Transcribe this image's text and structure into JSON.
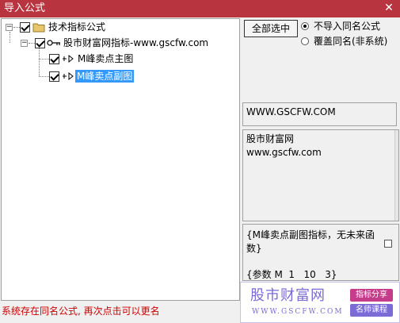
{
  "window": {
    "title": "导入公式"
  },
  "tree": {
    "root": {
      "label": "技术指标公式"
    },
    "group": {
      "label": "股市财富网指标-www.gscfw.com"
    },
    "items": [
      {
        "label": "M峰卖点主图"
      },
      {
        "label": "M峰卖点副图",
        "selected": true
      }
    ]
  },
  "controls": {
    "select_all": "全部选中",
    "radio_no_import": "不导入同名公式",
    "radio_overwrite": "覆盖同名(非系统)"
  },
  "fields": {
    "website": "WWW.GSCFW.COM",
    "description_line1": "股市财富网",
    "description_line2": "www.gscfw.com",
    "formula_line1": "{M峰卖点副图指标，无未来函",
    "formula_line2": "数}",
    "formula_line3": "{参数 M  1   10   3}"
  },
  "status": {
    "message": "系统存在同名公式, 再次点击可以更名"
  },
  "watermark": {
    "name": "股市财富网",
    "url": "WWW.GSCFW.COM",
    "tag1": "指标分享",
    "tag2": "名师课程"
  },
  "colors": {
    "titlebar": "#b8343f",
    "selection": "#3399ff",
    "status": "#d00000",
    "logo": "#7a6bd6"
  }
}
